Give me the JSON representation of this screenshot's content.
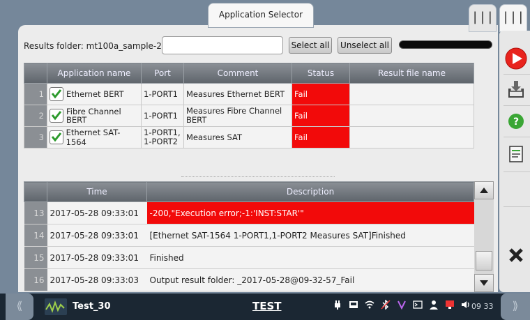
{
  "window": {
    "title": "Application Selector",
    "right_tabs": [
      "|||",
      "|||"
    ]
  },
  "toolbar": {
    "folder_label": "Results folder: mt100a_sample-2/",
    "folder_value": "",
    "select_all": "Select all",
    "unselect_all": "Unselect all",
    "progress": 0
  },
  "apps_table": {
    "headers": [
      "",
      "Application name",
      "Port",
      "Comment",
      "Status",
      "Result file name"
    ],
    "rows": [
      {
        "num": "1",
        "name": "Ethernet BERT",
        "port": "1-PORT1",
        "comment": "Measures Ethernet BERT",
        "status": "Fail",
        "result": ""
      },
      {
        "num": "2",
        "name": "Fibre Channel BERT",
        "port": "1-PORT1",
        "comment": "Measures Fibre Channel BERT",
        "status": "Fail",
        "result": ""
      },
      {
        "num": "3",
        "name": "Ethernet SAT-1564",
        "port": "1-PORT1, 1-PORT2",
        "comment": "Measures SAT",
        "status": "Fail",
        "result": ""
      }
    ]
  },
  "log_table": {
    "headers": [
      "",
      "Time",
      "Description"
    ],
    "rows": [
      {
        "num": "13",
        "time": "2017-05-28 09:33:01",
        "desc": "-200,\"Execution error;-1:'INST:STAR'\""
      },
      {
        "num": "14",
        "time": "2017-05-28 09:33:01",
        "desc": "[Ethernet SAT-1564 1-PORT1,1-PORT2 Measures SAT]Finished"
      },
      {
        "num": "15",
        "time": "2017-05-28 09:33:01",
        "desc": "Finished"
      },
      {
        "num": "16",
        "time": "2017-05-28 09:33:03",
        "desc": "Output result folder: _2017-05-28@09-32-57_Fail"
      }
    ]
  },
  "side_buttons": [
    "play-icon",
    "save-icon",
    "help-icon",
    "report-icon",
    "close-icon"
  ],
  "status_bar": {
    "name": "Test_30",
    "mode": "TEST",
    "time": "09 33",
    "left_arrows": "⟪",
    "right_arrows": "⟫"
  },
  "colors": {
    "fail": "#f20a0a",
    "play": "#e8231d",
    "help": "#3aa635"
  }
}
